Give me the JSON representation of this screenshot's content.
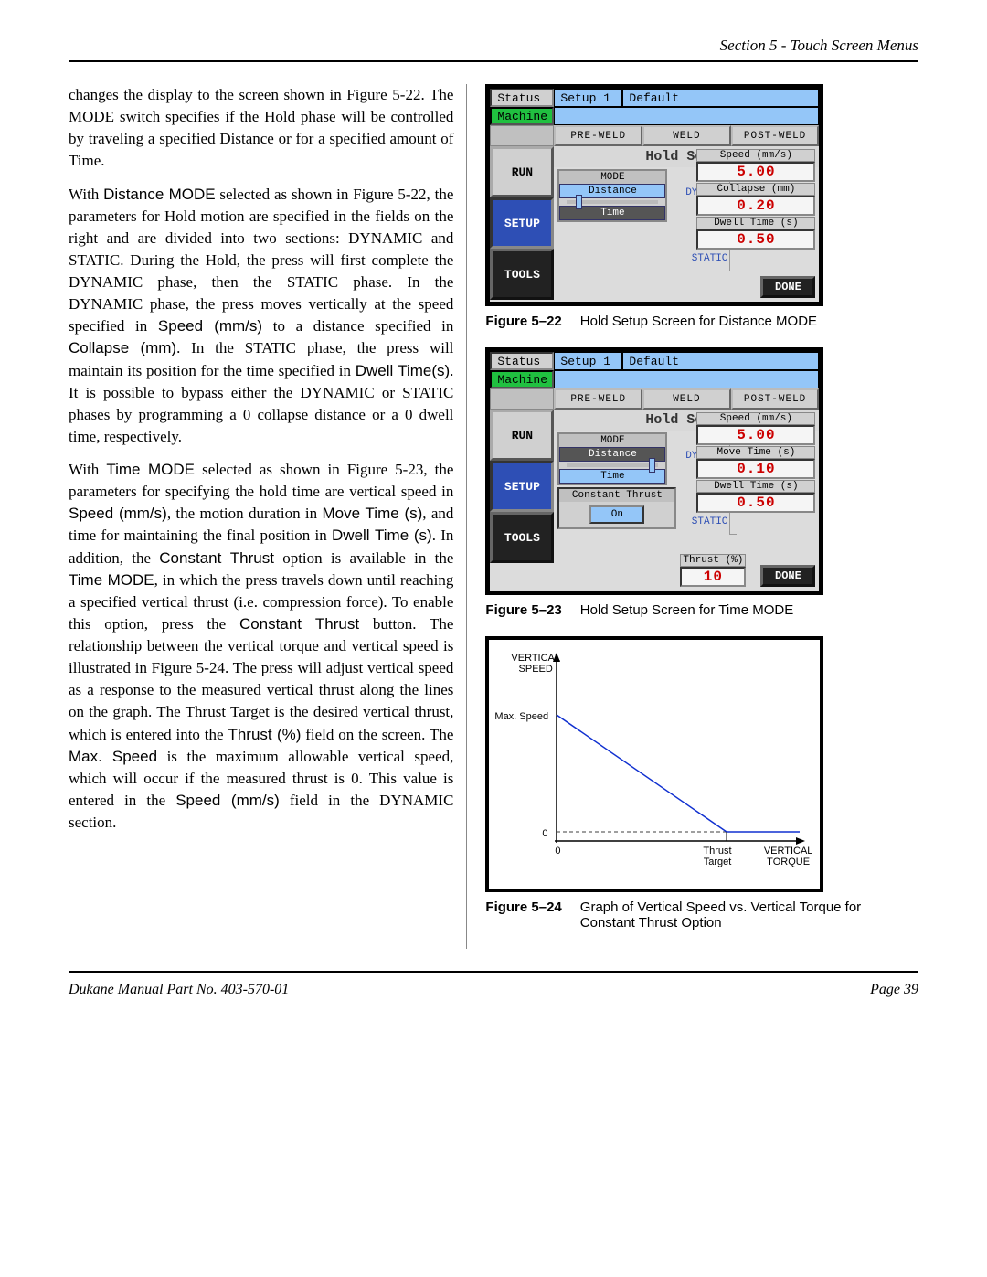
{
  "header": "Section 5 - Touch Screen Menus",
  "body": {
    "p1": "changes the display to the screen shown in Figure 5-22. The MODE switch specifies if the Hold phase will be controlled by traveling a specified Distance or for a specified amount of Time.",
    "p2a": "With ",
    "p2b": "Distance MODE",
    "p2c": " selected as shown in Figure 5-22, the parameters for Hold motion are specified in the fields on the right and are divided into two sections: DYNAMIC and STATIC. During the Hold, the press will first complete the DYNAMIC phase, then the STATIC phase. In the DYNAMIC phase, the press moves vertically at the speed specified in ",
    "p2d": "Speed (mm/s)",
    "p2e": " to a distance specified in ",
    "p2f": "Collapse (mm)",
    "p2g": ". In the STATIC phase, the press will maintain its position for the time specified in ",
    "p2h": "Dwell Time(s)",
    "p2i": ". It is possible to bypass either the DYNAMIC or STATIC phases by programming a 0 collapse distance or a 0 dwell time, respectively.",
    "p3a": "With ",
    "p3b": "Time MODE",
    "p3c": " selected as shown in Figure 5-23, the parameters for specifying the hold time are vertical speed in ",
    "p3d": "Speed (mm/s)",
    "p3e": ", the motion duration in ",
    "p3f": "Move Time (s)",
    "p3g": ", and time for maintaining the final position in ",
    "p3h": "Dwell Time (s)",
    "p3i": ". In addition, the ",
    "p3j": "Constant Thrust",
    "p3k": " option is available in the ",
    "p3l": "Time MODE",
    "p3m": ", in which the press travels down until reaching a specified vertical thrust (i.e. compression force). To enable this option, press the ",
    "p3n": "Constant Thrust",
    "p3o": " button. The relationship between the vertical torque and vertical speed is illustrated in Figure 5-24. The press will adjust vertical speed as a response to the measured vertical thrust along the lines on the graph. The Thrust Target is the desired vertical thrust, which is entered into the ",
    "p3p": "Thrust (%)",
    "p3q": " field on the screen. The ",
    "p3r": "Max. Speed",
    "p3s": " is the maximum allowable vertical speed, which will occur if the measured thrust is 0. This value is entered in the ",
    "p3t": "Speed (mm/s)",
    "p3u": " field in the DYNAMIC section."
  },
  "fig522": {
    "num": "Figure 5–22",
    "caption": "Hold Setup Screen for Distance MODE",
    "status": "Status",
    "setup1": "Setup 1",
    "default": "Default",
    "machine": "Machine",
    "preweld": "PRE-WELD",
    "weld": "WELD",
    "postweld": "POST-WELD",
    "title": "Hold Setup",
    "run": "RUN",
    "setup": "SETUP",
    "tools": "TOOLS",
    "mode": "MODE",
    "distance": "Distance",
    "time": "Time",
    "dynamic": "DYNAMIC",
    "static": "STATIC",
    "speed_lbl": "Speed (mm/s)",
    "speed_val": "5.00",
    "collapse_lbl": "Collapse (mm)",
    "collapse_val": "0.20",
    "dwell_lbl": "Dwell Time (s)",
    "dwell_val": "0.50",
    "done": "DONE"
  },
  "fig523": {
    "num": "Figure 5–23",
    "caption": "Hold Setup Screen for Time MODE",
    "speed_lbl": "Speed (mm/s)",
    "speed_val": "5.00",
    "move_lbl": "Move Time (s)",
    "move_val": "0.10",
    "dwell_lbl": "Dwell Time (s)",
    "dwell_val": "0.50",
    "ct": "Constant Thrust",
    "on": "On",
    "thrust_lbl": "Thrust (%)",
    "thrust_val": "10"
  },
  "fig524": {
    "num": "Figure 5–24",
    "caption": "Graph of Vertical Speed vs. Vertical Torque for Constant Thrust Option",
    "ylabel1": "VERTICAL",
    "ylabel2": "SPEED",
    "maxspeed": "Max. Speed",
    "zero": "0",
    "thrust1": "Thrust",
    "thrust2": "Target",
    "vt1": "VERTICAL",
    "vt2": "TORQUE"
  },
  "chart_data": {
    "type": "line",
    "title": "Vertical Speed vs. Vertical Torque",
    "xlabel": "Vertical Torque",
    "ylabel": "Vertical Speed",
    "x": [
      0,
      "Thrust Target"
    ],
    "y": [
      "Max. Speed",
      0
    ],
    "note": "Linear descent from (0, Max.Speed) to (Thrust Target, 0); speed is 0 beyond Thrust Target."
  },
  "footer": {
    "left": "Dukane Manual Part No. 403-570-01",
    "right": "Page   39"
  }
}
